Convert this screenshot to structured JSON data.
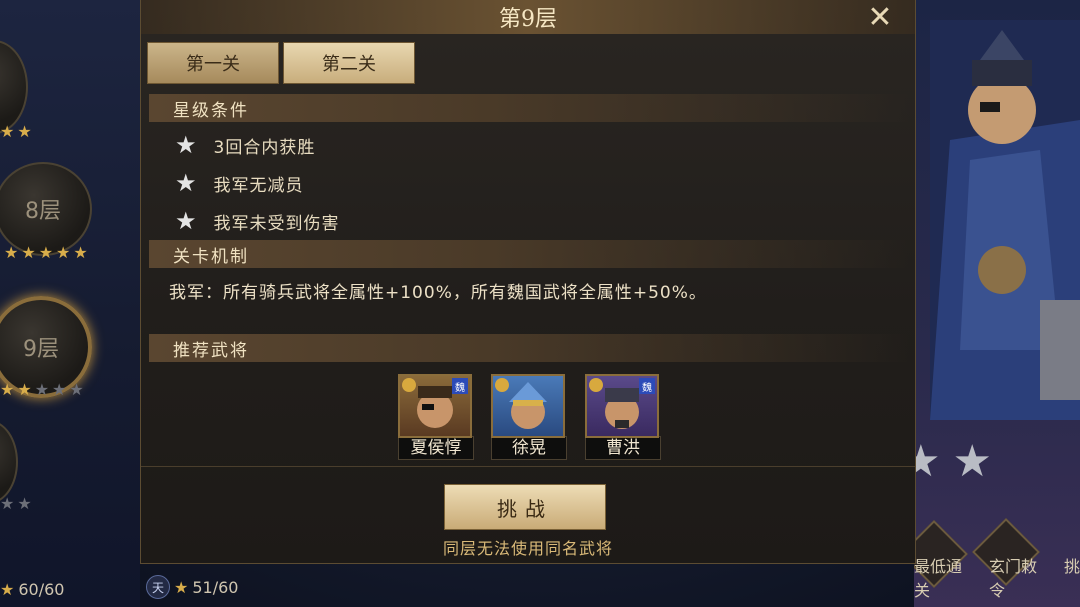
{
  "panel": {
    "title": "第9层",
    "close_icon": "close-x-icon",
    "tabs": [
      {
        "label": "第一关",
        "selected": false
      },
      {
        "label": "第二关",
        "selected": true
      }
    ],
    "star_conditions_title": "星级条件",
    "star_conditions": [
      "3回合内获胜",
      "我军无减员",
      "我军未受到伤害"
    ],
    "mechanic_title": "关卡机制",
    "mechanic_text": "我军：所有骑兵武将全属性+100%，所有魏国武将全属性+50%。",
    "recommend_title": "推荐武将",
    "heroes": [
      {
        "name": "夏侯惇",
        "faction": "魏"
      },
      {
        "name": "徐晃",
        "faction": "魏"
      },
      {
        "name": "曹洪",
        "faction": "魏"
      }
    ],
    "challenge_label": "挑战",
    "hint": "同层无法使用同名武将"
  },
  "left_tower": {
    "floors": [
      {
        "label": "8层",
        "active": false
      },
      {
        "label": "9层",
        "active": true
      }
    ],
    "stars_left": "60/60",
    "heaven_label": "天",
    "stars_heaven": "51/60"
  },
  "right_side": {
    "menu": [
      "最低通关",
      "玄门敕令",
      "挑"
    ]
  },
  "colors": {
    "gold": "#d8ad4b",
    "panel_bg": "#211e1b",
    "accent_button": "#c9ab77"
  }
}
